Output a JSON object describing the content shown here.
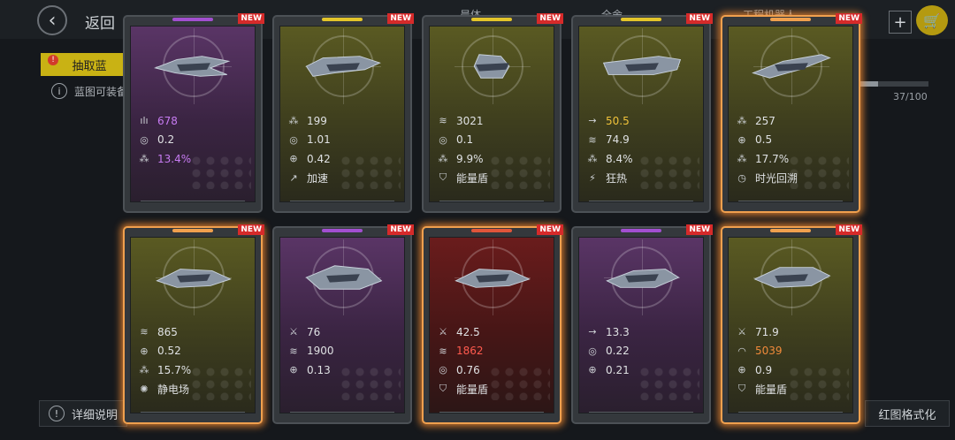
{
  "header": {
    "back_label": "返回",
    "tabs": [
      "晨体",
      "全舍",
      "工程机器人"
    ]
  },
  "draw_tab_label": "抽取蓝",
  "hint_text": "蓝图可装备",
  "progress": {
    "text": "37/100",
    "value": 0.37
  },
  "bottom": {
    "detail_label": "详细说明",
    "red_format_label": "红图格式化"
  },
  "new_badge": "NEW",
  "cards": [
    {
      "theme": "purple",
      "bar": "#a24fd0",
      "glow": false,
      "new": true,
      "stats": [
        {
          "icon": "bars-icon",
          "glyph": "ılı",
          "value": "678",
          "color": "#c77bf2"
        },
        {
          "icon": "fire-rate-icon",
          "glyph": "◎",
          "value": "0.2",
          "color": "#dfe1e3"
        },
        {
          "icon": "crit-icon",
          "glyph": "⁂",
          "value": "13.4%",
          "color": "#c77bf2"
        }
      ]
    },
    {
      "theme": "yellow",
      "bar": "#e4c52a",
      "glow": false,
      "new": true,
      "stats": [
        {
          "icon": "spread-icon",
          "glyph": "⁂",
          "value": "199",
          "color": "#dfe1e3"
        },
        {
          "icon": "fire-rate-icon",
          "glyph": "◎",
          "value": "1.01",
          "color": "#dfe1e3"
        },
        {
          "icon": "crosshair-icon",
          "glyph": "⊕",
          "value": "0.42",
          "color": "#dfe1e3"
        },
        {
          "icon": "accelerate-icon",
          "glyph": "↗",
          "value": "加速",
          "color": "#dfe1e3"
        }
      ]
    },
    {
      "theme": "yellow",
      "bar": "#e4c52a",
      "glow": false,
      "new": true,
      "stats": [
        {
          "icon": "armor-icon",
          "glyph": "≋",
          "value": "3021",
          "color": "#dfe1e3"
        },
        {
          "icon": "fire-rate-icon",
          "glyph": "◎",
          "value": "0.1",
          "color": "#dfe1e3"
        },
        {
          "icon": "crit-icon",
          "glyph": "⁂",
          "value": "9.9%",
          "color": "#dfe1e3"
        },
        {
          "icon": "shield-icon",
          "glyph": "⛉",
          "value": "能量盾",
          "color": "#dfe1e3"
        }
      ]
    },
    {
      "theme": "yellow",
      "bar": "#e4c52a",
      "glow": false,
      "new": true,
      "stats": [
        {
          "icon": "speed-icon",
          "glyph": "→",
          "value": "50.5",
          "color": "#f0c23a"
        },
        {
          "icon": "armor-icon",
          "glyph": "≋",
          "value": "74.9",
          "color": "#dfe1e3"
        },
        {
          "icon": "crit-icon",
          "glyph": "⁂",
          "value": "8.4%",
          "color": "#dfe1e3"
        },
        {
          "icon": "frenzy-icon",
          "glyph": "⚡",
          "value": "狂热",
          "color": "#dfe1e3"
        }
      ]
    },
    {
      "theme": "yellow",
      "bar": "#f0a04e",
      "glow": true,
      "new": true,
      "stats": [
        {
          "icon": "spread-icon",
          "glyph": "⁂",
          "value": "257",
          "color": "#dfe1e3"
        },
        {
          "icon": "crosshair-icon",
          "glyph": "⊕",
          "value": "0.5",
          "color": "#dfe1e3"
        },
        {
          "icon": "crit-icon",
          "glyph": "⁂",
          "value": "17.7%",
          "color": "#dfe1e3"
        },
        {
          "icon": "time-rewind-icon",
          "glyph": "◷",
          "value": "时光回溯",
          "color": "#dfe1e3"
        }
      ]
    },
    {
      "theme": "yellow",
      "bar": "#f0a04e",
      "glow": true,
      "new": true,
      "stats": [
        {
          "icon": "armor-icon",
          "glyph": "≋",
          "value": "865",
          "color": "#dfe1e3"
        },
        {
          "icon": "crosshair-icon",
          "glyph": "⊕",
          "value": "0.52",
          "color": "#dfe1e3"
        },
        {
          "icon": "crit-icon",
          "glyph": "⁂",
          "value": "15.7%",
          "color": "#dfe1e3"
        },
        {
          "icon": "static-field-icon",
          "glyph": "✺",
          "value": "静电场",
          "color": "#dfe1e3"
        }
      ]
    },
    {
      "theme": "purple",
      "bar": "#a24fd0",
      "glow": false,
      "new": true,
      "stats": [
        {
          "icon": "damage-icon",
          "glyph": "⚔",
          "value": "76",
          "color": "#dfe1e3"
        },
        {
          "icon": "armor-icon",
          "glyph": "≋",
          "value": "1900",
          "color": "#dfe1e3"
        },
        {
          "icon": "crosshair-icon",
          "glyph": "⊕",
          "value": "0.13",
          "color": "#dfe1e3"
        }
      ]
    },
    {
      "theme": "red",
      "bar": "#e0553a",
      "glow": true,
      "new": true,
      "stats": [
        {
          "icon": "damage-icon",
          "glyph": "⚔",
          "value": "42.5",
          "color": "#dfe1e3"
        },
        {
          "icon": "armor-icon",
          "glyph": "≋",
          "value": "1862",
          "color": "#ff5a4e"
        },
        {
          "icon": "fire-rate-icon",
          "glyph": "◎",
          "value": "0.76",
          "color": "#dfe1e3"
        },
        {
          "icon": "shield-icon",
          "glyph": "⛉",
          "value": "能量盾",
          "color": "#dfe1e3"
        }
      ]
    },
    {
      "theme": "purple",
      "bar": "#a24fd0",
      "glow": false,
      "new": true,
      "stats": [
        {
          "icon": "speed-icon",
          "glyph": "→",
          "value": "13.3",
          "color": "#dfe1e3"
        },
        {
          "icon": "fire-rate-icon",
          "glyph": "◎",
          "value": "0.22",
          "color": "#dfe1e3"
        },
        {
          "icon": "crosshair-icon",
          "glyph": "⊕",
          "value": "0.21",
          "color": "#dfe1e3"
        }
      ]
    },
    {
      "theme": "yellow",
      "bar": "#f0a04e",
      "glow": true,
      "new": true,
      "stats": [
        {
          "icon": "damage-icon",
          "glyph": "⚔",
          "value": "71.9",
          "color": "#dfe1e3"
        },
        {
          "icon": "hull-icon",
          "glyph": "◠",
          "value": "5039",
          "color": "#f08a3a"
        },
        {
          "icon": "crosshair-icon",
          "glyph": "⊕",
          "value": "0.9",
          "color": "#dfe1e3"
        },
        {
          "icon": "shield-icon",
          "glyph": "⛉",
          "value": "能量盾",
          "color": "#dfe1e3"
        }
      ]
    }
  ]
}
